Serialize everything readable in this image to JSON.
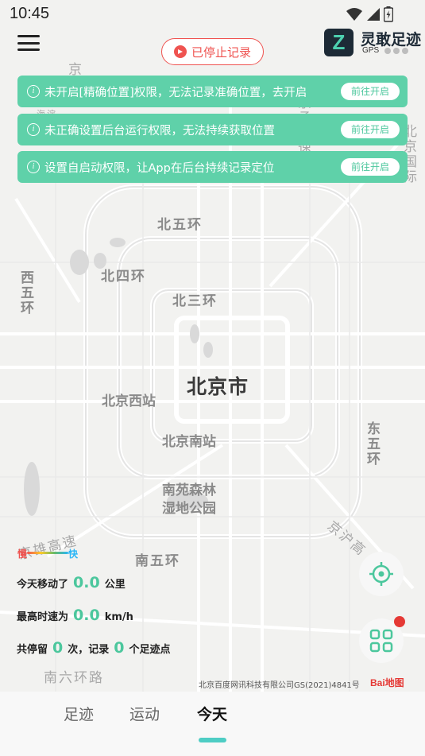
{
  "status_bar": {
    "time": "10:45"
  },
  "header": {
    "record_status": "已停止记录",
    "logo_mark": "Z",
    "app_name": "灵敢足迹",
    "app_sub": "GPS"
  },
  "banners": [
    {
      "text": "未开启[精确位置]权限，无法记录准确位置，去开启",
      "action": "前往开启"
    },
    {
      "text": "未正确设置后台运行权限，无法持续获取位置",
      "action": "前往开启"
    },
    {
      "text": "设置自启动权限，让App在后台持续记录定位",
      "action": "前往开启"
    }
  ],
  "map": {
    "labels": {
      "north5": "北五环",
      "north4": "北四环",
      "north3": "北三环",
      "west5": "西五环",
      "city": "北京市",
      "west_station": "北京西站",
      "south_station": "北京南站",
      "park": "南苑森林湿地公园",
      "east5": "东五环",
      "jinghu": "京沪高",
      "south5": "南五环",
      "south6": "南六环路",
      "jingxiong": "京雄高速",
      "haidian": "海淀",
      "jing": "京",
      "jingcheng": "京承高速",
      "airport": "北京国际"
    }
  },
  "speed_legend": {
    "slow": "慢",
    "fast": "快"
  },
  "stats": {
    "moved_prefix": "今天移动了",
    "moved_value": "0.0",
    "moved_unit": "公里",
    "speed_prefix": "最高时速为",
    "speed_value": "0.0",
    "speed_unit": "km/h",
    "stay_prefix": "共停留",
    "stay_count": "0",
    "stay_mid": "次，记录",
    "points_count": "0",
    "points_suffix": "个足迹点"
  },
  "copyright": "北京百度网讯科技有限公司GS(2021)4841号",
  "baidu_logo": "Bai地图",
  "tabs": [
    {
      "label": "足迹",
      "active": false
    },
    {
      "label": "运动",
      "active": false
    },
    {
      "label": "今天",
      "active": true
    }
  ],
  "colors": {
    "accent": "#4cc79d",
    "banner": "#5fd1a9",
    "record_red": "#ef5350"
  }
}
